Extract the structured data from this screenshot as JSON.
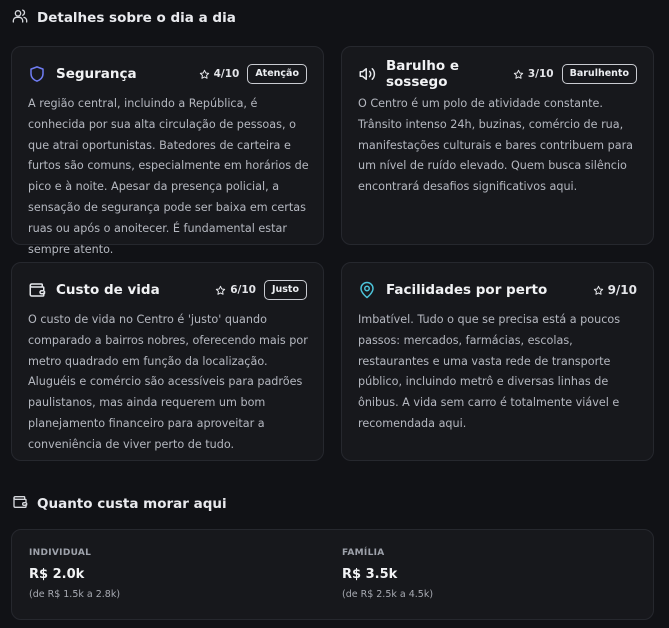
{
  "section_daily": {
    "title": "Detalhes sobre o dia a dia",
    "icon": "users-icon"
  },
  "cards": [
    {
      "title": "Segurança",
      "icon": "shield-icon",
      "score": "4/10",
      "badge": "Atenção",
      "text": "A região central, incluindo a República, é conhecida por sua alta circulação de pessoas, o que atrai oportunistas. Batedores de carteira e furtos são comuns, especialmente em horários de pico e à noite. Apesar da presença policial, a sensação de segurança pode ser baixa em certas ruas ou após o anoitecer. É fundamental estar sempre atento."
    },
    {
      "title": "Barulho e sossego",
      "icon": "volume-icon",
      "score": "3/10",
      "badge": "Barulhento",
      "text": "O Centro é um polo de atividade constante. Trânsito intenso 24h, buzinas, comércio de rua, manifestações culturais e bares contribuem para um nível de ruído elevado. Quem busca silêncio encontrará desafios significativos aqui."
    },
    {
      "title": "Custo de vida",
      "icon": "wallet-icon",
      "score": "6/10",
      "badge": "Justo",
      "text": "O custo de vida no Centro é 'justo' quando comparado a bairros nobres, oferecendo mais por metro quadrado em função da localização. Aluguéis e comércio são acessíveis para padrões paulistanos, mas ainda requerem um bom planejamento financeiro para aproveitar a conveniência de viver perto de tudo."
    },
    {
      "title": "Facilidades por perto",
      "icon": "map-pin-icon",
      "score": "9/10",
      "text": "Imbatível. Tudo o que se precisa está a poucos passos: mercados, farmácias, escolas, restaurantes e uma vasta rede de transporte público, incluindo metrô e diversas linhas de ônibus. A vida sem carro é totalmente viável e recomendada aqui."
    }
  ],
  "section_cost": {
    "title": "Quanto custa morar aqui",
    "icon": "wallet-icon",
    "individual": {
      "label": "INDIVIDUAL",
      "value": "R$ 2.0k",
      "range": "(de R$ 1.5k a 2.8k)"
    },
    "family": {
      "label": "FAMÍLIA",
      "value": "R$ 3.5k",
      "range": "(de R$ 2.5k a 4.5k)"
    }
  },
  "colors": {
    "background": "#111216",
    "card": "#17181c",
    "shield_icon": "#6f7cf2",
    "volume_icon": "#e5e7eb",
    "wallet_icon": "#e5e7eb",
    "map_pin_icon": "#4cc3d9"
  }
}
